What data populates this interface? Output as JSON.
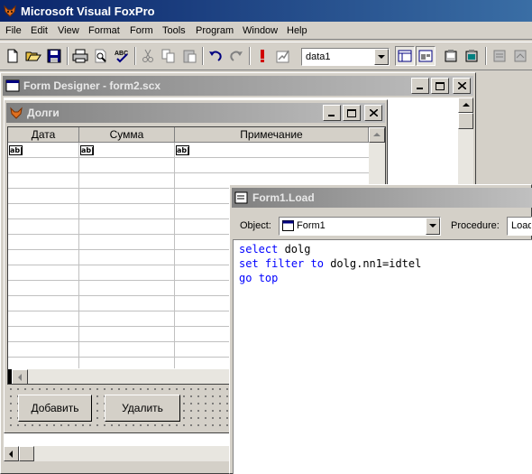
{
  "app": {
    "title": "Microsoft Visual FoxPro"
  },
  "menu": {
    "items": [
      "File",
      "Edit",
      "View",
      "Format",
      "Form",
      "Tools",
      "Program",
      "Window",
      "Help"
    ]
  },
  "toolbar": {
    "buttons": [
      "new-icon",
      "open-icon",
      "save-icon",
      "print-icon",
      "print-preview-icon",
      "spell-check-icon",
      "cut-icon",
      "copy-icon",
      "paste-icon",
      "undo-icon",
      "redo-icon",
      "run-icon",
      "modify-form-icon",
      "form-grid-icon",
      "form-layout-icon",
      "command-window-icon",
      "data-session-icon",
      "properties-icon",
      "code-window-icon"
    ],
    "datasource_value": "data1"
  },
  "form_designer": {
    "title": "Form Designer - form2.scx"
  },
  "dolgi_form": {
    "title": "Долги",
    "columns": [
      "Дата",
      "Сумма",
      "Примечание"
    ],
    "cell_marker": "ab|",
    "add_button_label": "Добавить",
    "delete_button_label": "Удалить"
  },
  "code_window": {
    "title": "Form1.Load",
    "object_label": "Object:",
    "object_value": "Form1",
    "procedure_label": "Procedure:",
    "procedure_value": "Load",
    "lines": [
      [
        {
          "t": "select",
          "k": true
        },
        {
          "t": " dolg",
          "k": false
        }
      ],
      [
        {
          "t": "set",
          "k": true
        },
        {
          "t": " ",
          "k": false
        },
        {
          "t": "filter",
          "k": true
        },
        {
          "t": " ",
          "k": false
        },
        {
          "t": "to",
          "k": true
        },
        {
          "t": " dolg.nn1=idtel",
          "k": false
        }
      ],
      [
        {
          "t": "go",
          "k": true
        },
        {
          "t": " ",
          "k": false
        },
        {
          "t": "top",
          "k": true
        }
      ]
    ]
  },
  "colors": {
    "title_active": "#0a246a",
    "keyword": "#0000ff"
  }
}
